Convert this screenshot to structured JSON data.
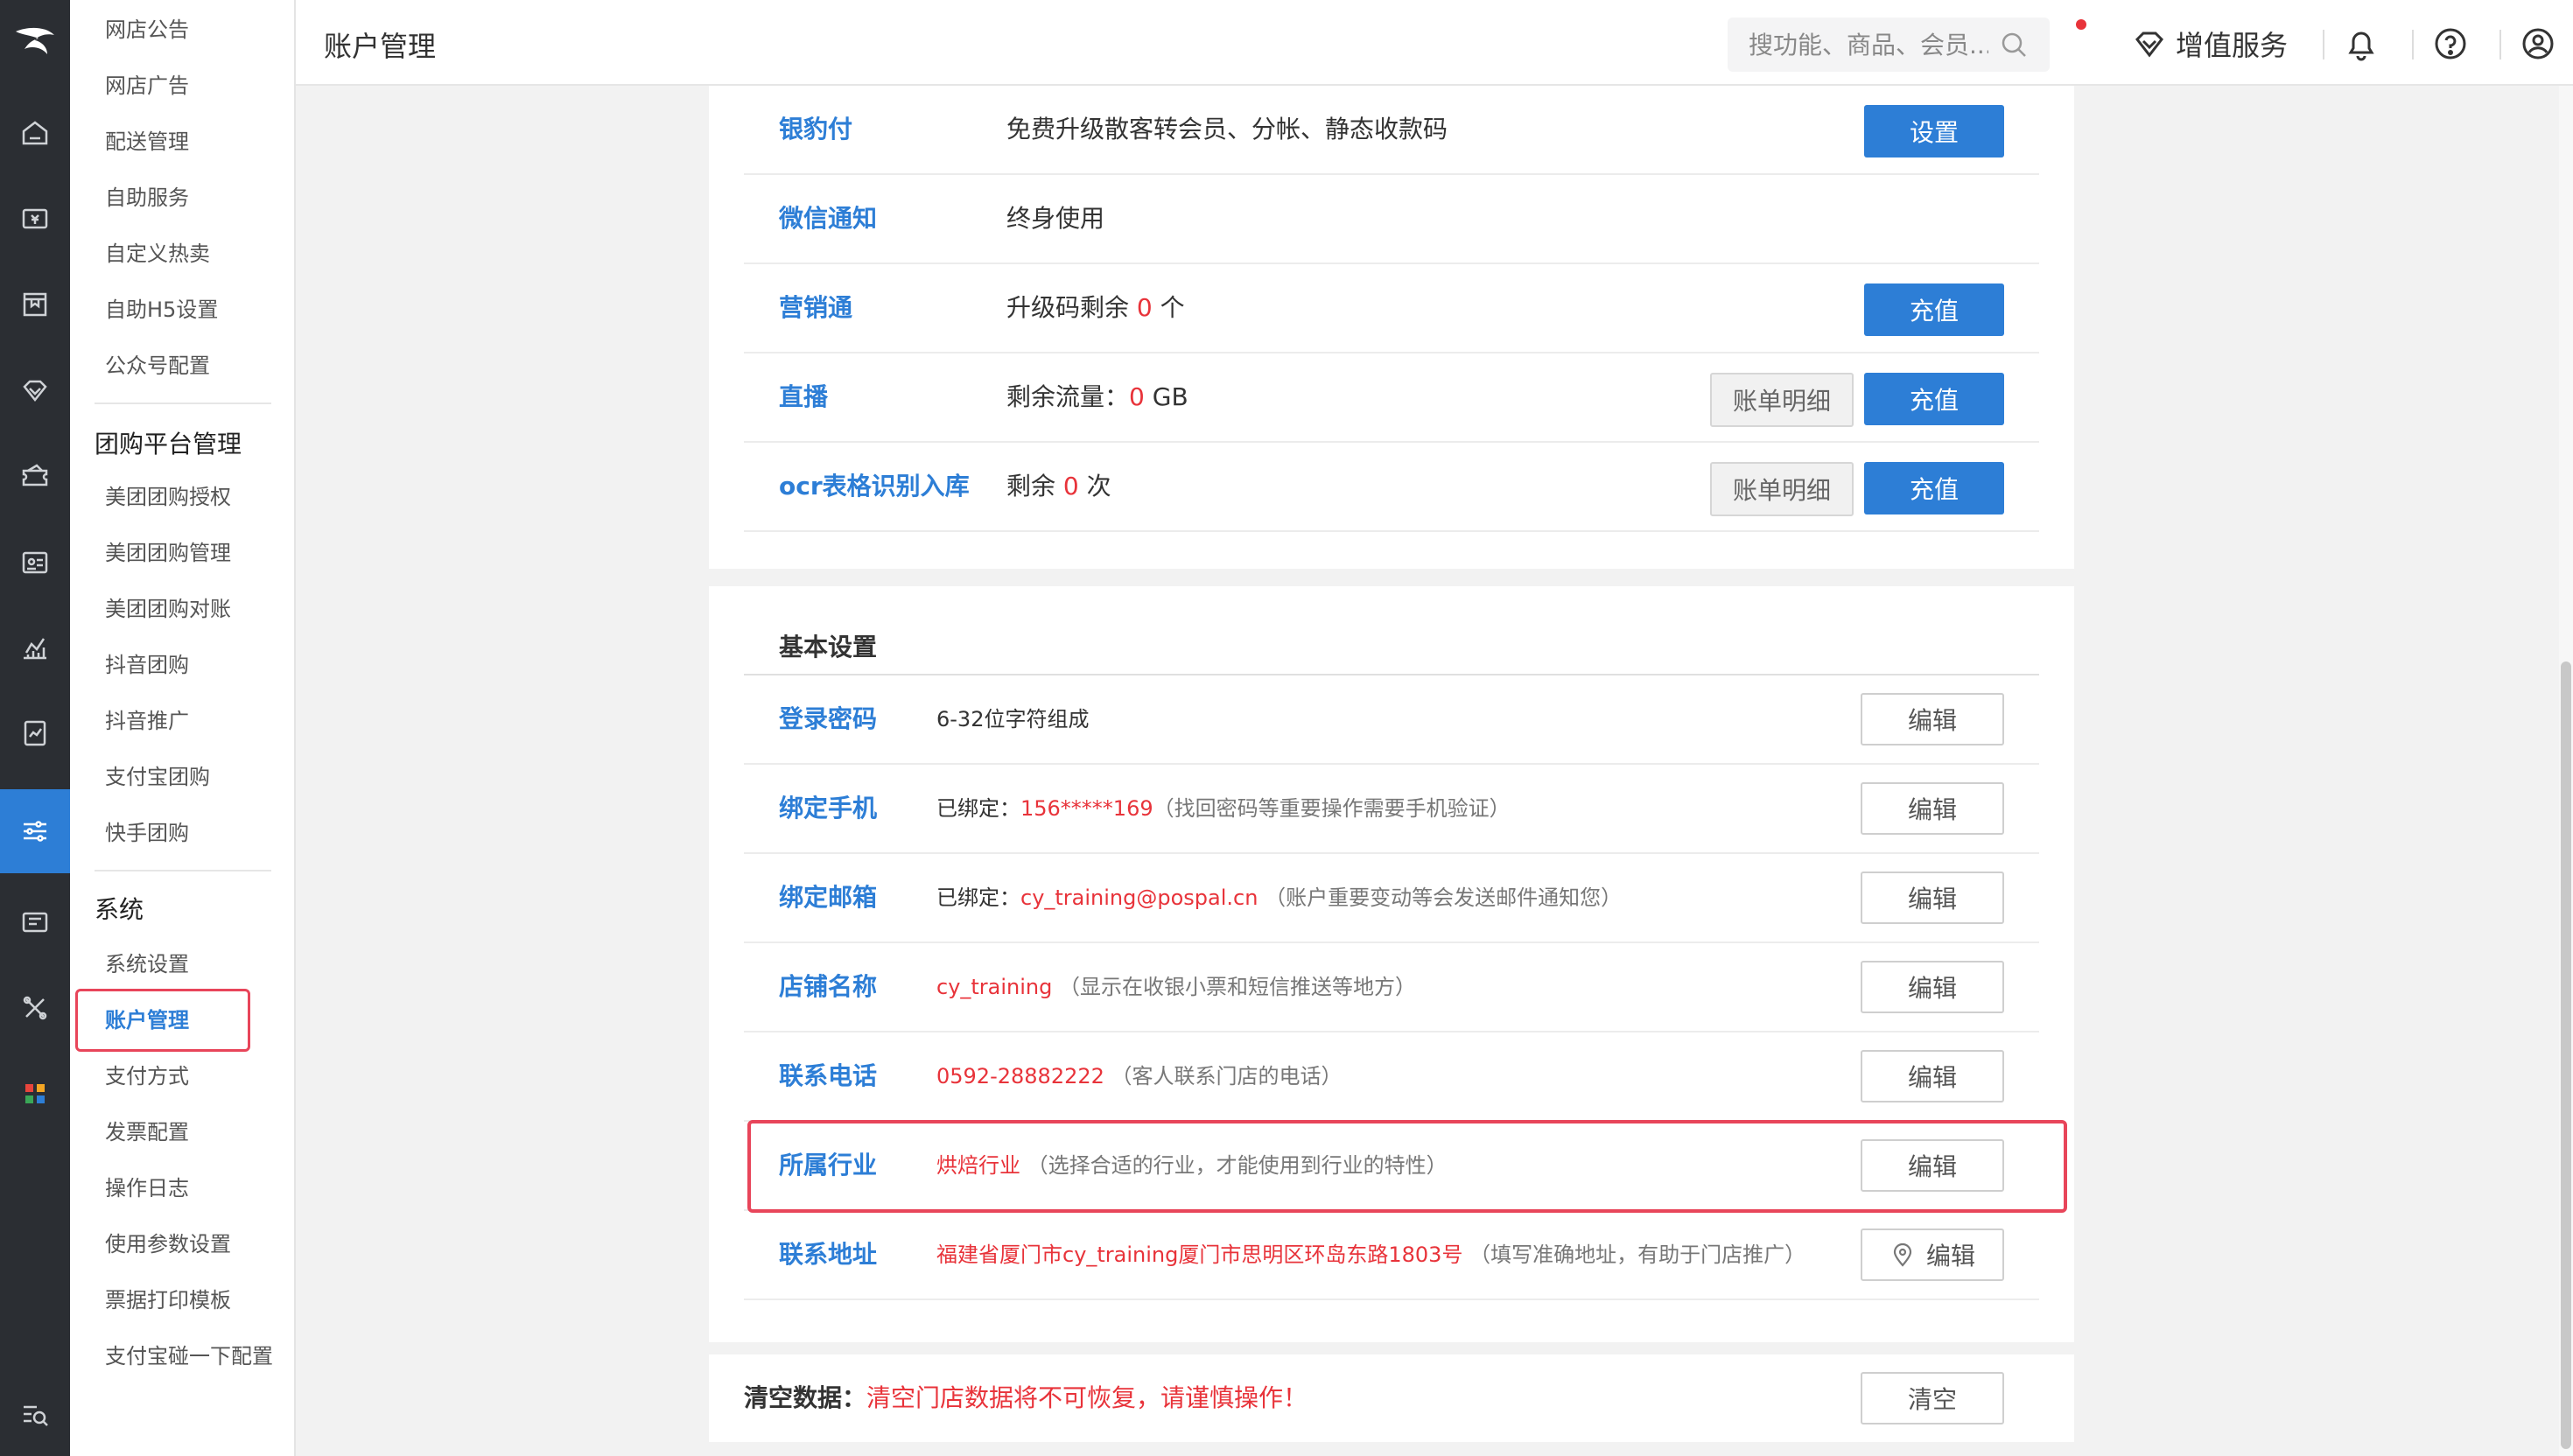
{
  "topbar": {
    "title": "账户管理",
    "search_placeholder": "搜功能、商品、会员...",
    "value_added": "增值服务"
  },
  "submenu": {
    "items_top": [
      "网店公告",
      "网店广告",
      "配送管理",
      "自助服务",
      "自定义热卖",
      "自助H5设置",
      "公众号配置"
    ],
    "group_tuangou": "团购平台管理",
    "items_tuangou": [
      "美团团购授权",
      "美团团购管理",
      "美团团购对账",
      "抖音团购",
      "抖音推广",
      "支付宝团购",
      "快手团购"
    ],
    "group_system": "系统",
    "items_system": [
      "系统设置",
      "账户管理",
      "支付方式",
      "发票配置",
      "操作日志",
      "使用参数设置",
      "票据打印模板",
      "支付宝碰一下配置"
    ]
  },
  "services": {
    "yinbaofu": {
      "label": "银豹付",
      "desc": "免费升级散客转会员、分帐、静态收款码",
      "button": "设置"
    },
    "weixin": {
      "label": "微信通知",
      "desc": "终身使用"
    },
    "yingxiao": {
      "label": "营销通",
      "desc_pre": "升级码剩余",
      "count": "0",
      "desc_post": "个",
      "button": "充值"
    },
    "zhibo": {
      "label": "直播",
      "desc_pre": "剩余流量：",
      "count": "0",
      "desc_post": "GB",
      "detail": "账单明细",
      "button": "充值"
    },
    "ocr": {
      "label": "ocr表格识别入库",
      "desc_pre": "剩余",
      "count": "0",
      "desc_post": "次",
      "detail": "账单明细",
      "button": "充值"
    }
  },
  "basic": {
    "title": "基本设置",
    "edit_label": "编辑",
    "password": {
      "label": "登录密码",
      "desc": "6-32位字符组成"
    },
    "phone": {
      "label": "绑定手机",
      "prefix": "已绑定：",
      "value": "156*****169",
      "note": "（找回密码等重要操作需要手机验证）"
    },
    "email": {
      "label": "绑定邮箱",
      "prefix": "已绑定：",
      "value": "cy_training@pospal.cn",
      "note": "（账户重要变动等会发送邮件通知您）"
    },
    "store": {
      "label": "店铺名称",
      "value": "cy_training",
      "note": "（显示在收银小票和短信推送等地方）"
    },
    "tel": {
      "label": "联系电话",
      "value": "0592-28882222",
      "note": "（客人联系门店的电话）"
    },
    "industry": {
      "label": "所属行业",
      "value": "烘焙行业",
      "note": "（选择合适的行业，才能使用到行业的特性）"
    },
    "address": {
      "label": "联系地址",
      "value": "福建省厦门市cy_training厦门市思明区环岛东路1803号",
      "note": "（填写准确地址，有助于门店推广）"
    }
  },
  "clear": {
    "label": "清空数据：",
    "warning": "清空门店数据将不可恢复，请谨慎操作！",
    "button": "清空"
  },
  "colors": {
    "primary": "#2d7ed6",
    "danger": "#e8333a",
    "rail": "#2b2e33"
  }
}
